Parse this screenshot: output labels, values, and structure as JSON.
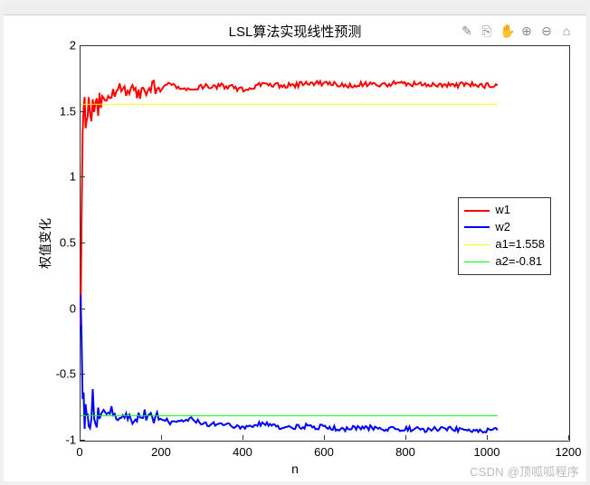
{
  "chart_data": {
    "type": "line",
    "title": "LSL算法实现线性预测",
    "xlabel": "n",
    "ylabel": "权值变化",
    "xlim": [
      0,
      1200
    ],
    "ylim": [
      -1,
      2
    ],
    "xticks": [
      0,
      200,
      400,
      600,
      800,
      1000,
      1200
    ],
    "yticks": [
      -1,
      -0.5,
      0,
      0.5,
      1,
      1.5,
      2
    ],
    "x": [
      0,
      5,
      10,
      15,
      20,
      30,
      40,
      50,
      60,
      80,
      100,
      120,
      150,
      180,
      200,
      220,
      260,
      300,
      350,
      400,
      450,
      500,
      550,
      600,
      650,
      700,
      750,
      800,
      850,
      900,
      950,
      1000,
      1024
    ],
    "series": [
      {
        "name": "w1",
        "color": "#ff0000",
        "width": 2,
        "values": [
          0.0,
          1.35,
          1.5,
          1.45,
          1.55,
          1.48,
          1.58,
          1.55,
          1.62,
          1.65,
          1.68,
          1.66,
          1.64,
          1.69,
          1.67,
          1.71,
          1.66,
          1.69,
          1.7,
          1.67,
          1.71,
          1.7,
          1.71,
          1.72,
          1.7,
          1.71,
          1.71,
          1.72,
          1.7,
          1.7,
          1.71,
          1.7,
          1.7
        ]
      },
      {
        "name": "w2",
        "color": "#0000ff",
        "width": 2,
        "values": [
          0.0,
          -0.6,
          -0.85,
          -0.78,
          -0.95,
          -0.7,
          -0.88,
          -0.78,
          -0.82,
          -0.78,
          -0.83,
          -0.85,
          -0.8,
          -0.82,
          -0.83,
          -0.86,
          -0.83,
          -0.87,
          -0.88,
          -0.89,
          -0.87,
          -0.9,
          -0.89,
          -0.9,
          -0.91,
          -0.9,
          -0.91,
          -0.91,
          -0.92,
          -0.91,
          -0.92,
          -0.92,
          -0.92
        ]
      },
      {
        "name": "a1=1.558",
        "color": "#ffff00",
        "width": 1,
        "const_y": 1.558,
        "x_range": [
          0,
          1024
        ]
      },
      {
        "name": "a2=-0.81",
        "color": "#00ff00",
        "width": 1,
        "const_y": -0.81,
        "x_range": [
          0,
          1024
        ]
      }
    ],
    "legend": {
      "position": "right",
      "entries": [
        "w1",
        "w2",
        "a1=1.558",
        "a2=-0.81"
      ]
    }
  },
  "axes_tools": {
    "brush": "✎",
    "datatip": "⎘",
    "pan": "✋",
    "zoom_in": "⊕",
    "zoom_out": "⊖",
    "home": "⌂"
  },
  "watermark": "CSDN @顶呱呱程序"
}
